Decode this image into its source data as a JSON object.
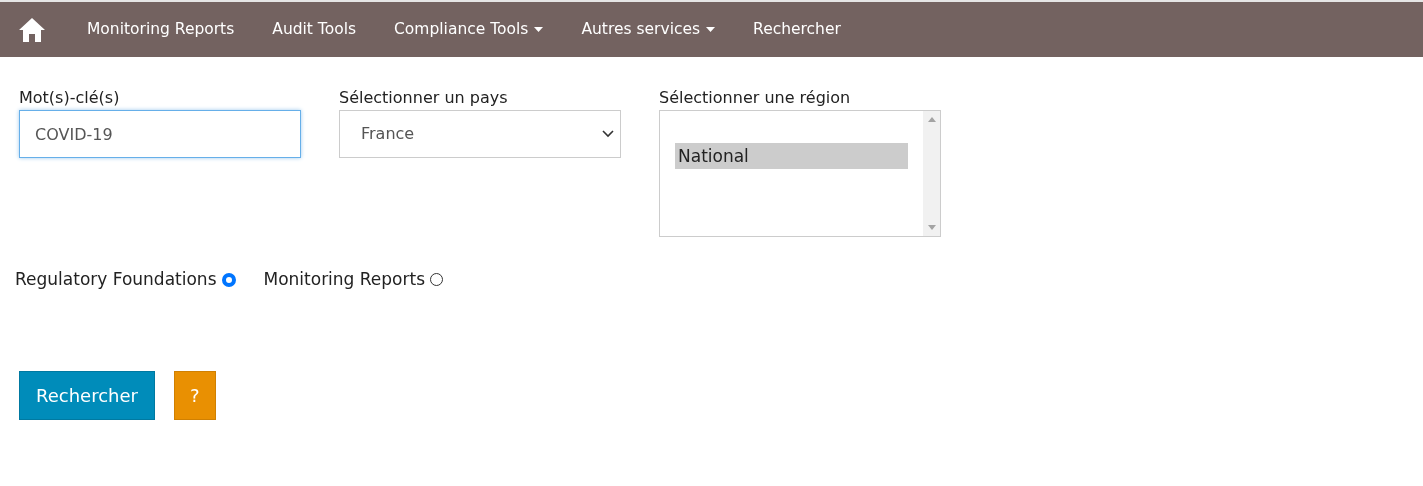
{
  "navbar": {
    "items": [
      {
        "label": "Monitoring Reports",
        "dropdown": false
      },
      {
        "label": "Audit Tools",
        "dropdown": false
      },
      {
        "label": "Compliance Tools",
        "dropdown": true
      },
      {
        "label": "Autres services",
        "dropdown": true
      },
      {
        "label": "Rechercher",
        "dropdown": false
      }
    ]
  },
  "keyword": {
    "label": "Mot(s)-clé(s)",
    "value": "COVID-19"
  },
  "country": {
    "label": "Sélectionner un pays",
    "value": "France"
  },
  "region": {
    "label": "Sélectionner une région",
    "options": [
      {
        "label": "National",
        "selected": true
      }
    ]
  },
  "sources": [
    {
      "label": "Regulatory Foundations",
      "checked": true
    },
    {
      "label": "Monitoring Reports",
      "checked": false
    }
  ],
  "buttons": [
    {
      "kind": "search",
      "label": "Rechercher"
    },
    {
      "kind": "help",
      "label": "?"
    }
  ]
}
